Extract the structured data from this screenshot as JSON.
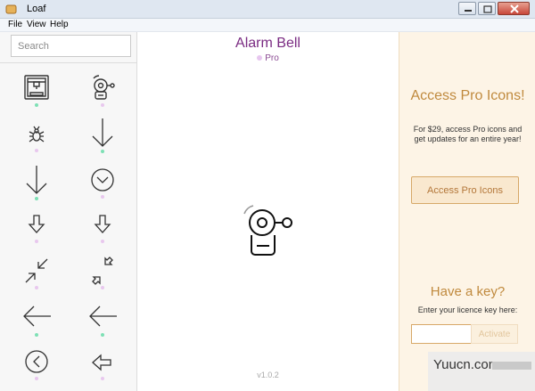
{
  "window": {
    "title": "Loaf",
    "app_icon": "loaf-app-icon",
    "controls": [
      "minimize-icon",
      "maximize-icon",
      "close-icon"
    ]
  },
  "menu": {
    "items": [
      "File",
      "View",
      "Help"
    ]
  },
  "sidebar": {
    "search_placeholder": "Search",
    "icons": [
      {
        "name": "3d-printer",
        "tier": "free"
      },
      {
        "name": "alarm-bell",
        "tier": "pro"
      },
      {
        "name": "bug",
        "tier": "pro"
      },
      {
        "name": "arrow-down-thin",
        "tier": "free"
      },
      {
        "name": "arrow-down-long",
        "tier": "free"
      },
      {
        "name": "arrow-down-circle",
        "tier": "pro"
      },
      {
        "name": "arrow-down-outline",
        "tier": "pro"
      },
      {
        "name": "arrow-down-outline-small",
        "tier": "pro"
      },
      {
        "name": "arrows-collapse",
        "tier": "pro"
      },
      {
        "name": "arrows-collapse-outline",
        "tier": "pro"
      },
      {
        "name": "arrow-left-long",
        "tier": "free"
      },
      {
        "name": "arrow-left-long-alt",
        "tier": "free"
      },
      {
        "name": "arrow-left-circle",
        "tier": "pro"
      },
      {
        "name": "arrow-left-outline",
        "tier": "pro"
      }
    ]
  },
  "preview": {
    "icon_name": "Alarm Bell",
    "tier_label": "Pro",
    "version": "v1.0.2"
  },
  "pro_panel": {
    "heading": "Access Pro Icons!",
    "description": "For $29, access Pro icons and get updates for an entire year!",
    "button_label": "Access Pro Icons",
    "key_heading": "Have a key?",
    "key_label": "Enter your licence key here:",
    "key_value": "",
    "activate_label": "Activate"
  },
  "watermark": {
    "text": "Yuucn.com"
  },
  "colors": {
    "free_dot": "#7ee0b5",
    "pro_dot": "#e8c8ee",
    "accent_purple": "#7a2b82",
    "pro_orange": "#c08a3e"
  }
}
